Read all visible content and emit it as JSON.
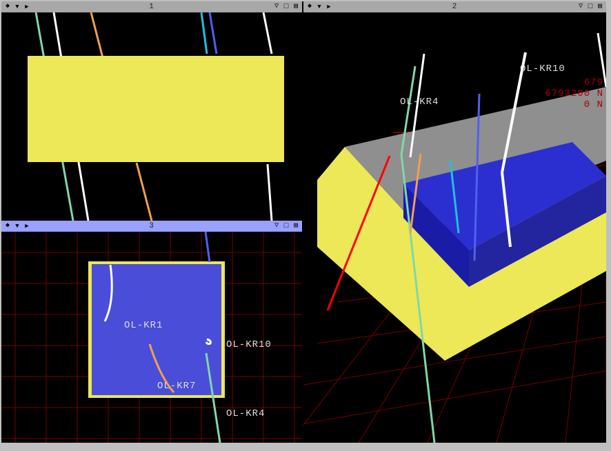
{
  "viewports": {
    "v1": {
      "title": "1"
    },
    "v2": {
      "title": "2"
    },
    "v3": {
      "title": "3"
    }
  },
  "labels": {
    "v2": {
      "kr4": "OL-KR4",
      "kr10": "OL-KR10",
      "coord1": "679",
      "coord2": "6793200 N",
      "coord3": "0 N"
    },
    "v3": {
      "kr1": "OL-KR1",
      "kr7": "OL-KR7",
      "kr4": "OL-KR4",
      "kr10": "OL-KR10"
    }
  },
  "colors": {
    "yellow_volume": "#ece857",
    "blue_volume": "#2c2fd0",
    "gray_top": "#8f8f8f",
    "grid_red": "#770000",
    "well_white": "#ffffff",
    "well_orange": "#f0a050",
    "well_cyan": "#20c0e0",
    "well_green": "#80d8a8",
    "well_blue": "#5060f0",
    "axis_red": "#ff0000"
  }
}
